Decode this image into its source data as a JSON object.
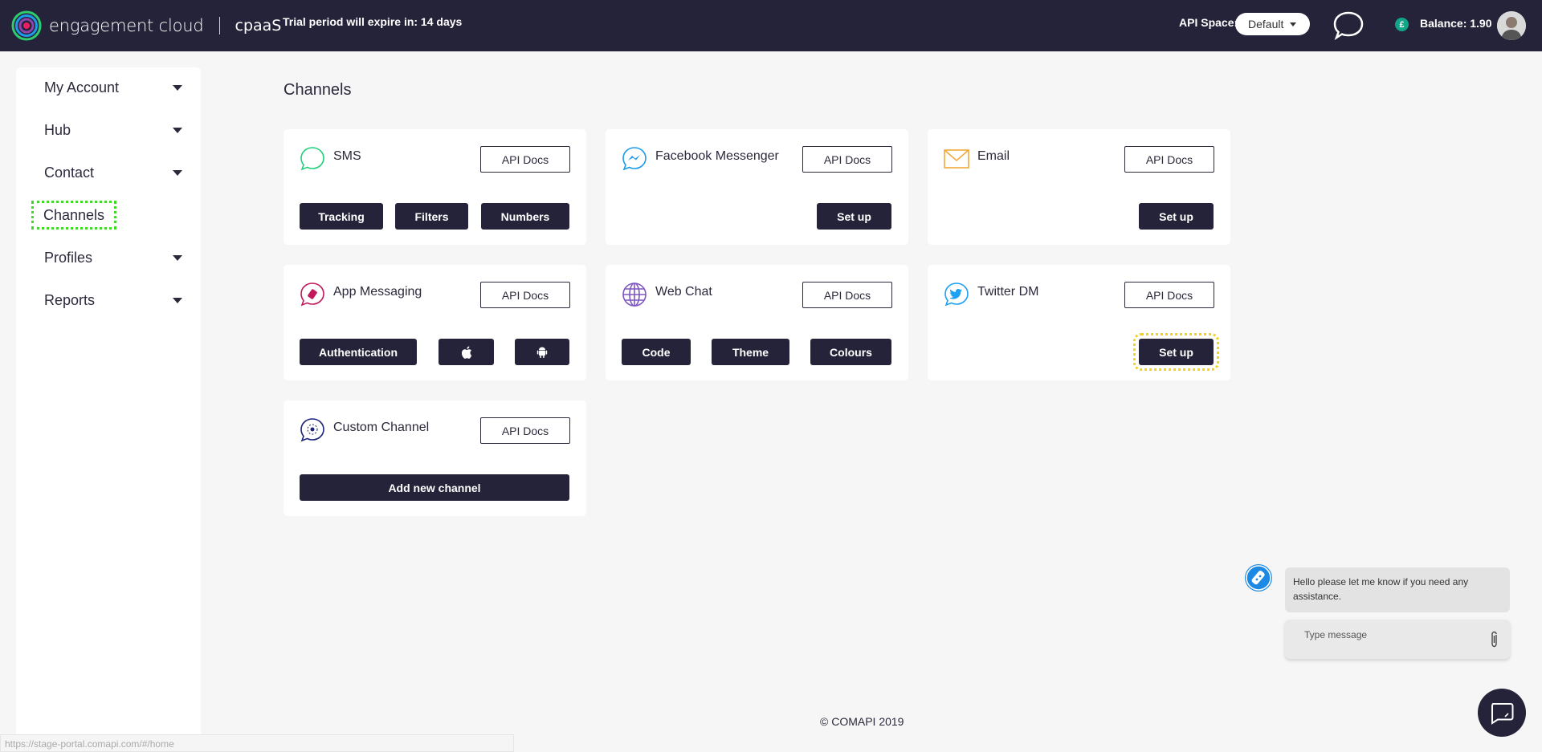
{
  "header": {
    "logo_text": "engagement cloud",
    "logo_product": "cpaaS",
    "trial_text": "Trial period will expire in: 14 days",
    "api_space_label": "API Space:",
    "api_space_value": "Default",
    "balance_symbol": "£",
    "balance_text": "Balance: 1.90"
  },
  "sidebar": {
    "items": [
      {
        "label": "My Account",
        "has_caret": true
      },
      {
        "label": "Hub",
        "has_caret": true
      },
      {
        "label": "Contact",
        "has_caret": true
      },
      {
        "label": "Channels",
        "has_caret": false,
        "active": true
      },
      {
        "label": "Profiles",
        "has_caret": true
      },
      {
        "label": "Reports",
        "has_caret": true
      }
    ]
  },
  "main": {
    "title": "Channels",
    "cards": [
      {
        "title": "SMS",
        "icon": "sms-icon",
        "api_docs": "API Docs",
        "buttons": [
          "Tracking",
          "Filters",
          "Numbers"
        ]
      },
      {
        "title": "Facebook Messenger",
        "icon": "messenger-icon",
        "api_docs": "API Docs",
        "buttons": [
          "Set up"
        ]
      },
      {
        "title": "Email",
        "icon": "email-icon",
        "api_docs": "API Docs",
        "buttons": [
          "Set up"
        ]
      },
      {
        "title": "App Messaging",
        "icon": "app-messaging-icon",
        "api_docs": "API Docs",
        "buttons": [
          "Authentication",
          "apple-icon",
          "android-icon"
        ]
      },
      {
        "title": "Web Chat",
        "icon": "globe-icon",
        "api_docs": "API Docs",
        "buttons": [
          "Code",
          "Theme",
          "Colours"
        ]
      },
      {
        "title": "Twitter DM",
        "icon": "twitter-icon",
        "api_docs": "API Docs",
        "buttons": [
          "Set up"
        ]
      },
      {
        "title": "Custom Channel",
        "icon": "custom-channel-icon",
        "api_docs": "API Docs",
        "buttons": [
          "Add new channel"
        ]
      }
    ]
  },
  "chat": {
    "bot_message": "Hello please let me know if you need any assistance.",
    "input_placeholder": "Type message"
  },
  "footer": {
    "copyright": "© COMAPI 2019",
    "status_url": "https://stage-portal.comapi.com/#/home"
  },
  "colors": {
    "header_bg": "#252339",
    "button_bg": "#252339",
    "active_outline": "#42d829",
    "highlight_outline": "#f3d21c",
    "sms": "#1fd17a",
    "messenger": "#1e9be8",
    "email": "#f2a93b",
    "app_messaging": "#c2185b",
    "web_chat": "#7e57c2",
    "twitter": "#1da1f2",
    "custom_channel": "#1a237e"
  }
}
